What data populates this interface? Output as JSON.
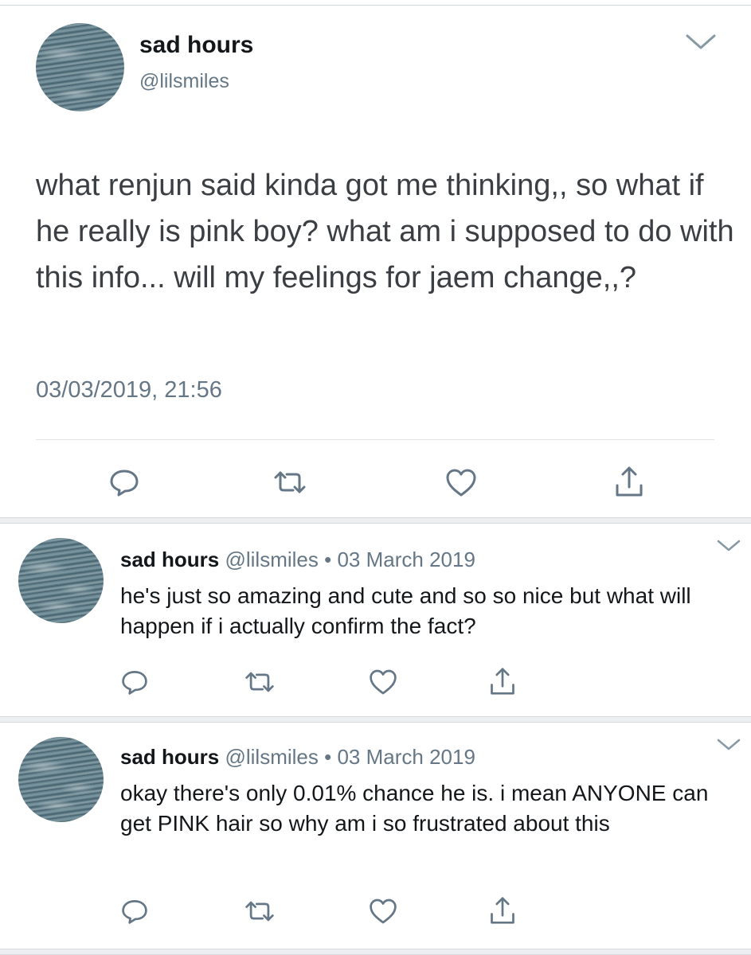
{
  "main_tweet": {
    "name": "sad hours",
    "handle": "@lilsmiles",
    "text": "what renjun said kinda got me thinking,, so what if he really is pink boy? what am i supposed to do with this info... will my feelings for jaem change,,?",
    "timestamp": "03/03/2019, 21:56"
  },
  "replies": [
    {
      "name": "sad hours",
      "handle": "@lilsmiles",
      "separator": "•",
      "date": "03 March 2019",
      "text": "he's just so amazing and cute and so so nice but what will happen if i actually confirm the fact?"
    },
    {
      "name": "sad hours",
      "handle": "@lilsmiles",
      "separator": "•",
      "date": "03 March 2019",
      "text": "okay there's only 0.01% chance he is. i mean ANYONE can get PINK hair so why am i so frustrated about this"
    }
  ],
  "icons": {
    "reply": "reply-icon",
    "retweet": "retweet-icon",
    "like": "heart-icon",
    "share": "share-icon",
    "menu": "chevron-down-icon"
  },
  "colors": {
    "text": "#14171a",
    "secondary": "#657786",
    "icon": "#657786"
  }
}
